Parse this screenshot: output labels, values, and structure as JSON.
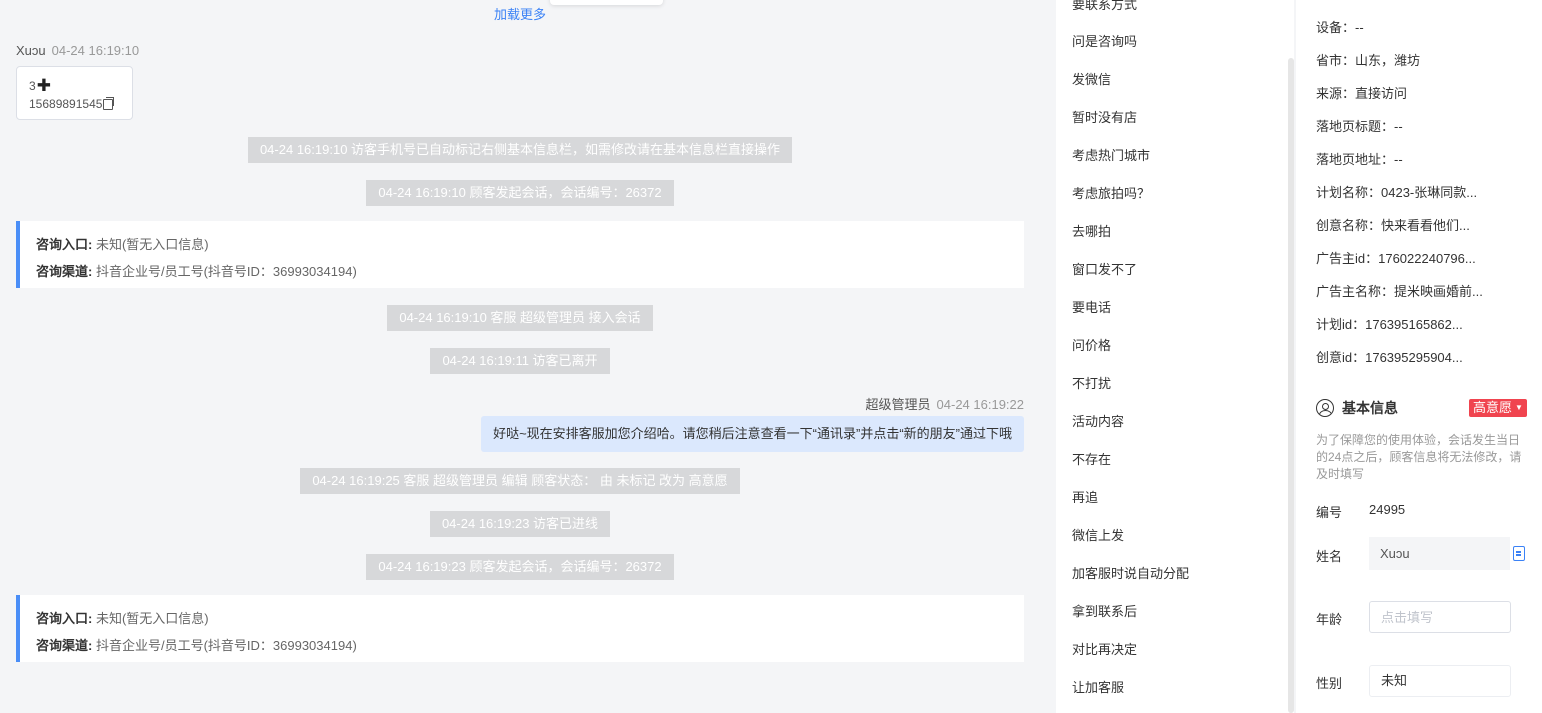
{
  "chat": {
    "load_more": "加载更多",
    "visitor_msg": {
      "name": "Xuↄu",
      "time": "04-24 16:19:10",
      "line1": "3",
      "phone": "15689891545"
    },
    "system_msgs": [
      "04-24 16:19:10 访客手机号已自动标记右侧基本信息栏，如需修改请在基本信息栏直接操作",
      "04-24 16:19:10 顾客发起会话，会话编号：26372",
      "04-24 16:19:10 客服 超级管理员 接入会话",
      "04-24 16:19:11 访客已离开",
      "04-24 16:19:25 客服 超级管理员 编辑 顾客状态： 由 未标记 改为 高意愿",
      "04-24 16:19:23 访客已进线",
      "04-24 16:19:23 顾客发起会话，会话编号：26372"
    ],
    "info_cards": [
      {
        "entry_label": "咨询入口:",
        "entry_value": "未知(暂无入口信息)",
        "channel_label": "咨询渠道:",
        "channel_value": "抖音企业号/员工号(抖音号ID：36993034194)"
      },
      {
        "entry_label": "咨询入口:",
        "entry_value": "未知(暂无入口信息)",
        "channel_label": "咨询渠道:",
        "channel_value": "抖音企业号/员工号(抖音号ID：36993034194)"
      }
    ],
    "agent_msg": {
      "name": "超级管理员",
      "time": "04-24 16:19:22",
      "text": "好哒~现在安排客服加您介绍哈。请您稍后注意查看一下“通讯录”并点击“新的朋友”通过下哦"
    }
  },
  "quick_replies": [
    "要联系方式",
    "问是咨询吗",
    "发微信",
    "暂时没有店",
    "考虑热门城市",
    "考虑旅拍吗？",
    "去哪拍",
    "窗口发不了",
    "要电话",
    "问价格",
    "不打扰",
    "活动内容",
    "不存在",
    "再追",
    "微信上发",
    "加客服时说自动分配",
    "拿到联系后",
    "对比再决定",
    "让加客服"
  ],
  "panel": {
    "details": [
      "设备：--",
      "省市：山东，潍坊",
      "来源：直接访问",
      "落地页标题：--",
      "落地页地址：--",
      "计划名称：0423-张琳同款...",
      "创意名称：快来看看他们...",
      "广告主id：176022240796...",
      "广告主名称：提米映画婚前...",
      "计划id：176395165862...",
      "创意id：176395295904..."
    ],
    "basic_title": "基本信息",
    "level_tag": "高意愿",
    "notice": "为了保障您的使用体验，会话发生当日的24点之后，顾客信息将无法修改，请及时填写",
    "id_label": "编号",
    "id_value": "24995",
    "name_label": "姓名",
    "name_value": "Xuↄu",
    "age_label": "年龄",
    "age_placeholder": "点击填写",
    "gender_label": "性别",
    "gender_value": "未知"
  },
  "colors": {
    "accent_blue": "#3b82f6",
    "card_border": "#4a8ef7",
    "agent_bubble": "#dbe8fd",
    "system_bg": "#d7d8da",
    "tag_red": "#f0444f"
  }
}
